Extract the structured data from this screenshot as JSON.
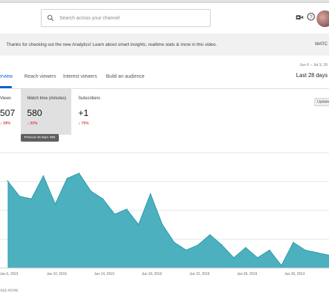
{
  "search": {
    "placeholder": "Search across your channel"
  },
  "top_icons": [
    "video-camera-icon",
    "help-icon",
    "avatar"
  ],
  "banner": {
    "text": "Thanks for checking out the new Analytics! Learn about smart insights, realtime stats & more in this video.",
    "action": "WATC"
  },
  "tabs": [
    {
      "label": "erview",
      "active": true
    },
    {
      "label": "Reach viewers",
      "active": false
    },
    {
      "label": "Interest viewers",
      "active": false
    },
    {
      "label": "Build an audience",
      "active": false
    }
  ],
  "date_range": {
    "sub": "Jun 6 – Jul 3, 20",
    "main": "Last 28 days"
  },
  "metrics": [
    {
      "label": "Views",
      "value": "507",
      "change": "↓ 28%"
    },
    {
      "label": "Watch time (minutes)",
      "value": "580",
      "change": "↓ 32%",
      "selected": true
    },
    {
      "label": "Subscribers",
      "value": "+1",
      "change": "↓ 75%"
    }
  ],
  "update_button": "Update",
  "tooltip": "Previous 28 days: 859",
  "colors": {
    "accent": "#065fd4",
    "chart_fill": "#4cb0bf",
    "chart_line": "#2b9aab",
    "down": "#cc0000"
  },
  "chart_data": {
    "type": "area",
    "x": [
      "Jun 6",
      "Jun 7",
      "Jun 8",
      "Jun 9",
      "Jun 10",
      "Jun 11",
      "Jun 12",
      "Jun 13",
      "Jun 14",
      "Jun 15",
      "Jun 16",
      "Jun 17",
      "Jun 18",
      "Jun 19",
      "Jun 20",
      "Jun 21",
      "Jun 22",
      "Jun 23",
      "Jun 24",
      "Jun 25",
      "Jun 26",
      "Jun 27",
      "Jun 28",
      "Jun 29",
      "Jun 30",
      "Jul 1",
      "Jul 2",
      "Jul 3"
    ],
    "values": [
      34,
      28,
      27,
      36,
      25,
      35,
      37,
      30,
      27,
      21,
      23,
      17,
      29,
      17,
      10,
      7,
      9,
      13,
      9,
      4,
      8,
      4,
      7,
      1,
      10,
      7,
      6,
      5
    ],
    "ylim": [
      0,
      45
    ],
    "tick_labels": [
      "Jun 6, 2019",
      "Jun 10, 2019",
      "Jun 14, 2019",
      "Jun 18, 2019",
      "Jun 22, 2019",
      "Jun 26, 2019",
      "Jun 30, 2019"
    ],
    "grid": true
  },
  "footer": "SEE MORE"
}
